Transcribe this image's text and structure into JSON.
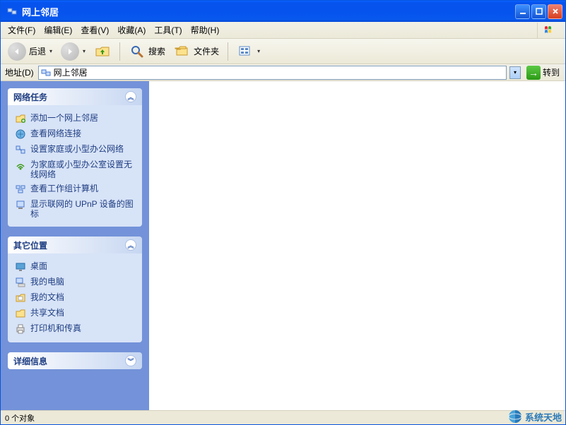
{
  "window": {
    "title": "网上邻居"
  },
  "menu": {
    "file": "文件(F)",
    "edit": "编辑(E)",
    "view": "查看(V)",
    "fav": "收藏(A)",
    "tools": "工具(T)",
    "help": "帮助(H)"
  },
  "toolbar": {
    "back": "后退",
    "search": "搜索",
    "folders": "文件夹"
  },
  "address": {
    "label": "地址(D)",
    "value": "网上邻居",
    "go": "转到"
  },
  "panels": {
    "network": {
      "title": "网络任务",
      "items": [
        "添加一个网上邻居",
        "查看网络连接",
        "设置家庭或小型办公网络",
        "为家庭或小型办公室设置无线网络",
        "查看工作组计算机",
        "显示联网的 UPnP 设备的图标"
      ]
    },
    "other": {
      "title": "其它位置",
      "items": [
        "桌面",
        "我的电脑",
        "我的文档",
        "共享文档",
        "打印机和传真"
      ]
    },
    "details": {
      "title": "详细信息"
    }
  },
  "status": "0 个对象",
  "watermark": "系统天地"
}
